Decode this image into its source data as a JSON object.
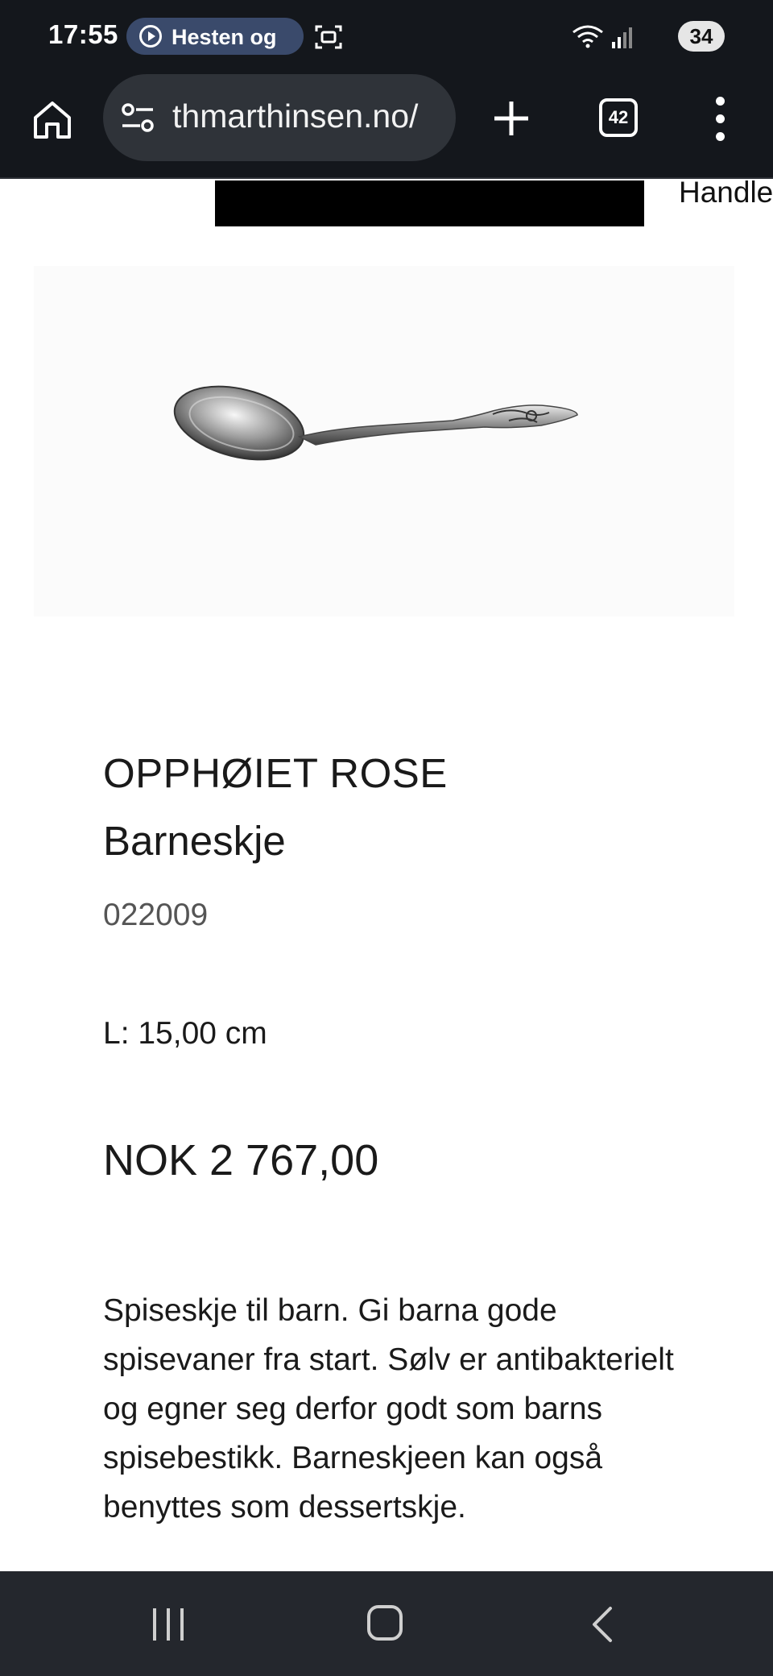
{
  "status_bar": {
    "time": "17:55",
    "media_chip_text": "Hesten og",
    "battery": "34",
    "icons": [
      "play-circle-icon",
      "screenshot-icon",
      "wifi-icon",
      "signal-icon"
    ]
  },
  "browser": {
    "url": "thmarthinsen.no/",
    "tab_count": "42",
    "icons": [
      "home-icon",
      "tune-icon",
      "plus-icon",
      "more-vert-icon"
    ]
  },
  "page": {
    "header_link": "Handle",
    "product": {
      "title": "OPPHØIET ROSE",
      "subtitle": "Barneskje",
      "sku": "022009",
      "length": "L: 15,00 cm",
      "price": "NOK 2 767,00",
      "description": "Spiseskje til barn. Gi barna gode spisevaner fra start. Sølv er antibakterielt og egner seg derfor godt som barns spisebestikk. Barneskjeen kan også benyttes som dessertskje."
    }
  },
  "nav_bar": {
    "icons": [
      "recent-apps-icon",
      "home-circle-icon",
      "back-icon"
    ]
  },
  "colors": {
    "system_bar": "#14171c",
    "url_pill": "#2f3339",
    "media_chip": "#3a4a6b",
    "nav_bar": "#24272d"
  }
}
